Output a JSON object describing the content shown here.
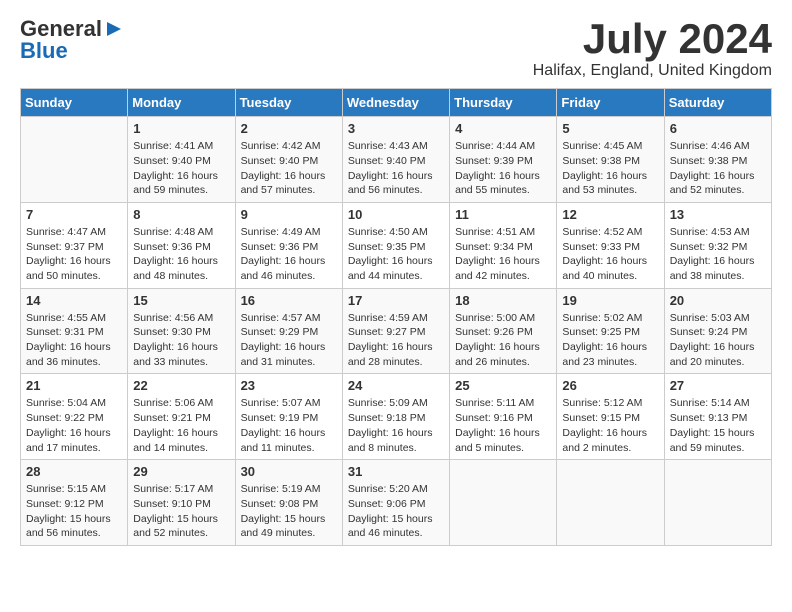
{
  "header": {
    "logo_general": "General",
    "logo_blue": "Blue",
    "month": "July 2024",
    "location": "Halifax, England, United Kingdom"
  },
  "days_of_week": [
    "Sunday",
    "Monday",
    "Tuesday",
    "Wednesday",
    "Thursday",
    "Friday",
    "Saturday"
  ],
  "weeks": [
    [
      {
        "day": "",
        "info": ""
      },
      {
        "day": "1",
        "info": "Sunrise: 4:41 AM\nSunset: 9:40 PM\nDaylight: 16 hours and 59 minutes."
      },
      {
        "day": "2",
        "info": "Sunrise: 4:42 AM\nSunset: 9:40 PM\nDaylight: 16 hours and 57 minutes."
      },
      {
        "day": "3",
        "info": "Sunrise: 4:43 AM\nSunset: 9:40 PM\nDaylight: 16 hours and 56 minutes."
      },
      {
        "day": "4",
        "info": "Sunrise: 4:44 AM\nSunset: 9:39 PM\nDaylight: 16 hours and 55 minutes."
      },
      {
        "day": "5",
        "info": "Sunrise: 4:45 AM\nSunset: 9:38 PM\nDaylight: 16 hours and 53 minutes."
      },
      {
        "day": "6",
        "info": "Sunrise: 4:46 AM\nSunset: 9:38 PM\nDaylight: 16 hours and 52 minutes."
      }
    ],
    [
      {
        "day": "7",
        "info": "Sunrise: 4:47 AM\nSunset: 9:37 PM\nDaylight: 16 hours and 50 minutes."
      },
      {
        "day": "8",
        "info": "Sunrise: 4:48 AM\nSunset: 9:36 PM\nDaylight: 16 hours and 48 minutes."
      },
      {
        "day": "9",
        "info": "Sunrise: 4:49 AM\nSunset: 9:36 PM\nDaylight: 16 hours and 46 minutes."
      },
      {
        "day": "10",
        "info": "Sunrise: 4:50 AM\nSunset: 9:35 PM\nDaylight: 16 hours and 44 minutes."
      },
      {
        "day": "11",
        "info": "Sunrise: 4:51 AM\nSunset: 9:34 PM\nDaylight: 16 hours and 42 minutes."
      },
      {
        "day": "12",
        "info": "Sunrise: 4:52 AM\nSunset: 9:33 PM\nDaylight: 16 hours and 40 minutes."
      },
      {
        "day": "13",
        "info": "Sunrise: 4:53 AM\nSunset: 9:32 PM\nDaylight: 16 hours and 38 minutes."
      }
    ],
    [
      {
        "day": "14",
        "info": "Sunrise: 4:55 AM\nSunset: 9:31 PM\nDaylight: 16 hours and 36 minutes."
      },
      {
        "day": "15",
        "info": "Sunrise: 4:56 AM\nSunset: 9:30 PM\nDaylight: 16 hours and 33 minutes."
      },
      {
        "day": "16",
        "info": "Sunrise: 4:57 AM\nSunset: 9:29 PM\nDaylight: 16 hours and 31 minutes."
      },
      {
        "day": "17",
        "info": "Sunrise: 4:59 AM\nSunset: 9:27 PM\nDaylight: 16 hours and 28 minutes."
      },
      {
        "day": "18",
        "info": "Sunrise: 5:00 AM\nSunset: 9:26 PM\nDaylight: 16 hours and 26 minutes."
      },
      {
        "day": "19",
        "info": "Sunrise: 5:02 AM\nSunset: 9:25 PM\nDaylight: 16 hours and 23 minutes."
      },
      {
        "day": "20",
        "info": "Sunrise: 5:03 AM\nSunset: 9:24 PM\nDaylight: 16 hours and 20 minutes."
      }
    ],
    [
      {
        "day": "21",
        "info": "Sunrise: 5:04 AM\nSunset: 9:22 PM\nDaylight: 16 hours and 17 minutes."
      },
      {
        "day": "22",
        "info": "Sunrise: 5:06 AM\nSunset: 9:21 PM\nDaylight: 16 hours and 14 minutes."
      },
      {
        "day": "23",
        "info": "Sunrise: 5:07 AM\nSunset: 9:19 PM\nDaylight: 16 hours and 11 minutes."
      },
      {
        "day": "24",
        "info": "Sunrise: 5:09 AM\nSunset: 9:18 PM\nDaylight: 16 hours and 8 minutes."
      },
      {
        "day": "25",
        "info": "Sunrise: 5:11 AM\nSunset: 9:16 PM\nDaylight: 16 hours and 5 minutes."
      },
      {
        "day": "26",
        "info": "Sunrise: 5:12 AM\nSunset: 9:15 PM\nDaylight: 16 hours and 2 minutes."
      },
      {
        "day": "27",
        "info": "Sunrise: 5:14 AM\nSunset: 9:13 PM\nDaylight: 15 hours and 59 minutes."
      }
    ],
    [
      {
        "day": "28",
        "info": "Sunrise: 5:15 AM\nSunset: 9:12 PM\nDaylight: 15 hours and 56 minutes."
      },
      {
        "day": "29",
        "info": "Sunrise: 5:17 AM\nSunset: 9:10 PM\nDaylight: 15 hours and 52 minutes."
      },
      {
        "day": "30",
        "info": "Sunrise: 5:19 AM\nSunset: 9:08 PM\nDaylight: 15 hours and 49 minutes."
      },
      {
        "day": "31",
        "info": "Sunrise: 5:20 AM\nSunset: 9:06 PM\nDaylight: 15 hours and 46 minutes."
      },
      {
        "day": "",
        "info": ""
      },
      {
        "day": "",
        "info": ""
      },
      {
        "day": "",
        "info": ""
      }
    ]
  ]
}
